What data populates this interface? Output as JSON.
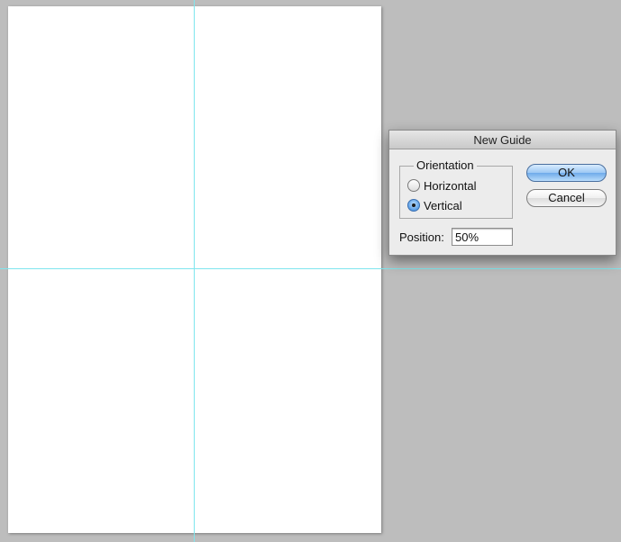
{
  "dialog": {
    "title": "New Guide",
    "orientation": {
      "legend": "Orientation",
      "options": [
        {
          "label": "Horizontal",
          "checked": false
        },
        {
          "label": "Vertical",
          "checked": true
        }
      ]
    },
    "position": {
      "label": "Position:",
      "value": "50%"
    },
    "buttons": {
      "ok_label": "OK",
      "cancel_label": "Cancel"
    }
  },
  "colors": {
    "guide": "#7fe6ee",
    "workspace": "#bdbdbd",
    "document": "#ffffff",
    "default_button": "#6eaaea"
  }
}
